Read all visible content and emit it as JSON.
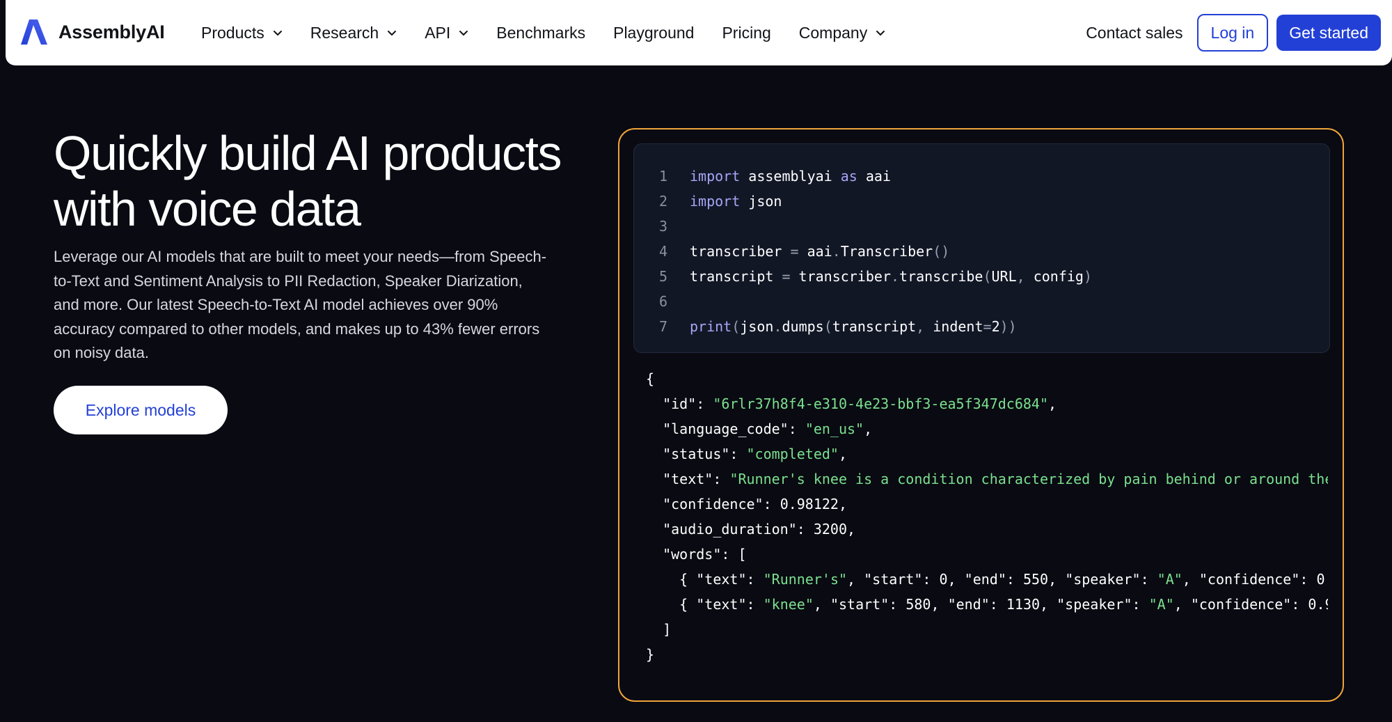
{
  "nav": {
    "logo_text": "AssemblyAI",
    "items": [
      {
        "label": "Products",
        "has_dropdown": true
      },
      {
        "label": "Research",
        "has_dropdown": true
      },
      {
        "label": "API",
        "has_dropdown": true
      },
      {
        "label": "Benchmarks",
        "has_dropdown": false
      },
      {
        "label": "Playground",
        "has_dropdown": false
      },
      {
        "label": "Pricing",
        "has_dropdown": false
      },
      {
        "label": "Company",
        "has_dropdown": true
      }
    ],
    "contact_label": "Contact sales",
    "login_label": "Log in",
    "get_started_label": "Get started"
  },
  "hero": {
    "title_line1": "Quickly build AI products",
    "title_line2": "with voice data",
    "desc_lines": [
      "Leverage our AI models that are built to meet your needs—from Speech-",
      "to-Text and Sentiment Analysis to PII Redaction, Speaker Diarization,",
      "and more. Our latest Speech-to-Text AI model achieves over 90%",
      "accuracy compared to other models, and makes up to 43% fewer errors",
      "on noisy data."
    ],
    "cta_label": "Explore models"
  },
  "code": {
    "line_numbers": [
      "1",
      "2",
      "3",
      "4",
      "5",
      "6",
      "7"
    ],
    "lines": {
      "l1_kw1": "import",
      "l1_mod": " assemblyai ",
      "l1_kw2": "as",
      "l1_alias": " aai",
      "l2_kw": "import",
      "l2_mod": " json",
      "l4_a": "transcriber ",
      "l4_eq": "=",
      "l4_b": " aai",
      "l4_dot": ".",
      "l4_c": "Transcriber",
      "l4_p": "()",
      "l5_a": "transcript ",
      "l5_eq": "=",
      "l5_b": " transcriber",
      "l5_dot": ".",
      "l5_c": "transcribe",
      "l5_p1": "(",
      "l5_d": "URL",
      "l5_comma": ",",
      "l5_e": " config",
      "l5_p2": ")",
      "l7_fn": "print",
      "l7_p1": "(",
      "l7_a": "json",
      "l7_dot": ".",
      "l7_b": "dumps",
      "l7_p2": "(",
      "l7_c": "transcript",
      "l7_comma": ",",
      "l7_d": " indent",
      "l7_eq": "=",
      "l7_e": "2",
      "l7_p3": "))"
    }
  },
  "output": {
    "open_brace": "{",
    "id_key": "\"id\"",
    "id_val": "\"6rlr37h8f4-e310-4e23-bbf3-ea5f347dc684\"",
    "lang_key": "\"language_code\"",
    "lang_val": "\"en_us\"",
    "status_key": "\"status\"",
    "status_val": "\"completed\"",
    "text_key": "\"text\"",
    "text_val": "\"Runner's knee is a condition characterized by pain behind or around the",
    "conf_key": "\"confidence\"",
    "conf_val": "0.98122",
    "dur_key": "\"audio_duration\"",
    "dur_val": "3200",
    "words_key": "\"words\"",
    "words_open": "[",
    "word1": {
      "open": "{ ",
      "text_key": "\"text\"",
      "text_val": "\"Runner's\"",
      "start_key": "\"start\"",
      "start_val": "0",
      "end_key": "\"end\"",
      "end_val": "550",
      "spk_key": "\"speaker\"",
      "spk_val": "\"A\"",
      "conf_key": "\"confidence\"",
      "conf_val": "0"
    },
    "word2": {
      "open": "{ ",
      "text_key": "\"text\"",
      "text_val": "\"knee\"",
      "start_key": "\"start\"",
      "start_val": "580",
      "end_key": "\"end\"",
      "end_val": "1130",
      "spk_key": "\"speaker\"",
      "spk_val": "\"A\"",
      "conf_key": "\"confidence\"",
      "conf_val": "0.9"
    },
    "words_close": "]",
    "close_brace": "}"
  },
  "colors": {
    "brand_blue": "#2340d6",
    "panel_border": "#f0a43a",
    "string_green": "#7be08e",
    "keyword_purple": "#a6a6f5",
    "background": "#090a12"
  },
  "icons": {
    "logo": "assemblyai-logo-icon",
    "dropdown": "chevron-down-icon"
  }
}
